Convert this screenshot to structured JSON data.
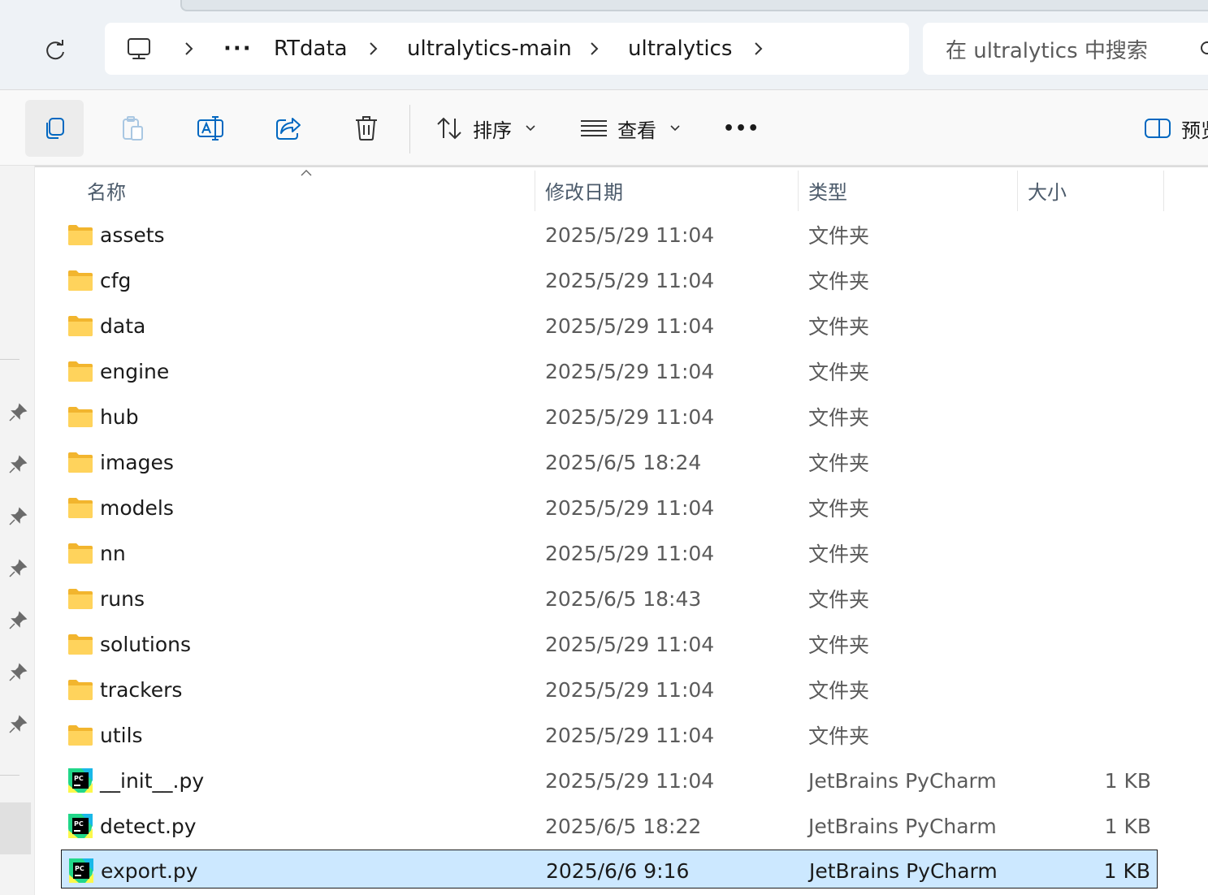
{
  "breadcrumb": {
    "overflow_label": "···",
    "items": [
      "RTdata",
      "ultralytics-main",
      "ultralytics"
    ]
  },
  "search": {
    "placeholder": "在 ultralytics 中搜索"
  },
  "toolbar": {
    "sort_label": "排序",
    "view_label": "查看",
    "more_label": "•••",
    "preview_label": "预览"
  },
  "columns": {
    "name": "名称",
    "date": "修改日期",
    "type": "类型",
    "size": "大小"
  },
  "files": [
    {
      "name": "assets",
      "date": "2025/5/29 11:04",
      "type": "文件夹",
      "size": "",
      "kind": "folder"
    },
    {
      "name": "cfg",
      "date": "2025/5/29 11:04",
      "type": "文件夹",
      "size": "",
      "kind": "folder"
    },
    {
      "name": "data",
      "date": "2025/5/29 11:04",
      "type": "文件夹",
      "size": "",
      "kind": "folder"
    },
    {
      "name": "engine",
      "date": "2025/5/29 11:04",
      "type": "文件夹",
      "size": "",
      "kind": "folder"
    },
    {
      "name": "hub",
      "date": "2025/5/29 11:04",
      "type": "文件夹",
      "size": "",
      "kind": "folder"
    },
    {
      "name": "images",
      "date": "2025/6/5 18:24",
      "type": "文件夹",
      "size": "",
      "kind": "folder"
    },
    {
      "name": "models",
      "date": "2025/5/29 11:04",
      "type": "文件夹",
      "size": "",
      "kind": "folder"
    },
    {
      "name": "nn",
      "date": "2025/5/29 11:04",
      "type": "文件夹",
      "size": "",
      "kind": "folder"
    },
    {
      "name": "runs",
      "date": "2025/6/5 18:43",
      "type": "文件夹",
      "size": "",
      "kind": "folder"
    },
    {
      "name": "solutions",
      "date": "2025/5/29 11:04",
      "type": "文件夹",
      "size": "",
      "kind": "folder"
    },
    {
      "name": "trackers",
      "date": "2025/5/29 11:04",
      "type": "文件夹",
      "size": "",
      "kind": "folder"
    },
    {
      "name": "utils",
      "date": "2025/5/29 11:04",
      "type": "文件夹",
      "size": "",
      "kind": "folder"
    },
    {
      "name": "__init__.py",
      "date": "2025/5/29 11:04",
      "type": "JetBrains PyCharm",
      "size": "1 KB",
      "kind": "pycharm"
    },
    {
      "name": "detect.py",
      "date": "2025/6/5 18:22",
      "type": "JetBrains PyCharm",
      "size": "1 KB",
      "kind": "pycharm"
    },
    {
      "name": "export.py",
      "date": "2025/6/6 9:16",
      "type": "JetBrains PyCharm",
      "size": "1 KB",
      "kind": "pycharm",
      "selected": true
    }
  ],
  "icons": {
    "refresh": "refresh-icon",
    "computer": "computer-icon",
    "copy": "copy-icon",
    "paste": "paste-icon",
    "rename": "rename-icon",
    "share": "share-icon",
    "delete": "delete-icon",
    "sort": "sort-icon",
    "view": "view-icon",
    "preview": "preview-pane-icon",
    "pin": "pin-icon",
    "folder": "folder-icon",
    "pycharm": "pycharm-file-icon"
  },
  "colors": {
    "selection_bg": "#cce8ff",
    "folder_yellow": "#ffd35c",
    "accent": "#0067c0"
  }
}
